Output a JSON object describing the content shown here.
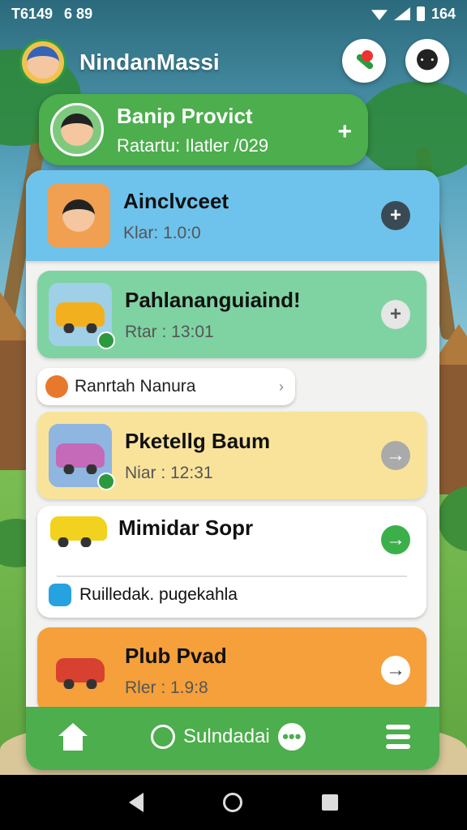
{
  "status_bar": {
    "time": "T6149",
    "extra": "6 89",
    "battery": "164"
  },
  "header": {
    "app_title": "NindanMassi"
  },
  "banner": {
    "title": "Banip Provict",
    "subtitle": "Ratartu: Ilatler /029",
    "action": "+"
  },
  "cards": [
    {
      "title": "Ainclvceet",
      "subtitle": "Klar: 1.0:0",
      "action": "+"
    },
    {
      "title": "Pahlananguiaind!",
      "subtitle": "Rtar : 13:01",
      "action": "+"
    },
    {
      "title": "Pketellg Baum",
      "subtitle": "Niar : 12:31",
      "action": "→"
    }
  ],
  "chip": {
    "label": "Ranrtah Nanura",
    "arrow": "›"
  },
  "white_card": {
    "title": "Mimidar Sopr",
    "subtitle": "Ruilledak. pugekahla",
    "action": "→"
  },
  "last_card": {
    "title": "Plub Pvad",
    "subtitle": "Rler : 1.9:8",
    "action": "→"
  },
  "bottom_nav": {
    "center_label": "Sulndadai",
    "more": "•••"
  },
  "colors": {
    "green": "#4cae4c",
    "blue_card": "#6ec3ec",
    "yellow_card": "#f9e39b",
    "orange_card": "#f5a03a",
    "mint_card": "#7fd3a2"
  }
}
